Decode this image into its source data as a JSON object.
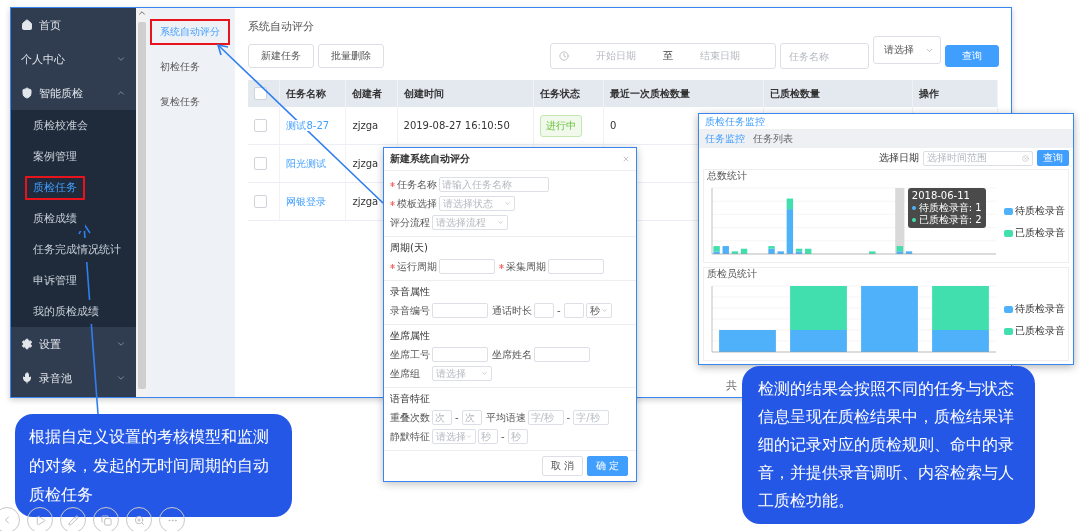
{
  "sidebar": {
    "items": [
      {
        "label": "首页",
        "kind": "link",
        "selected": false
      },
      {
        "label": "个人中心",
        "kind": "group",
        "expanded": false
      },
      {
        "label": "智能质检",
        "kind": "group",
        "expanded": true,
        "children": [
          {
            "label": "质检校准会",
            "selected": false,
            "highlighted": false
          },
          {
            "label": "案例管理",
            "selected": false,
            "highlighted": false
          },
          {
            "label": "质检任务",
            "selected": true,
            "highlighted": true
          },
          {
            "label": "质检成绩",
            "selected": false,
            "highlighted": false
          },
          {
            "label": "任务完成情况统计",
            "selected": false,
            "highlighted": false
          },
          {
            "label": "申诉管理",
            "selected": false,
            "highlighted": false
          },
          {
            "label": "我的质检成绩",
            "selected": false,
            "highlighted": false
          }
        ]
      },
      {
        "label": "设置",
        "kind": "group",
        "expanded": false
      },
      {
        "label": "录音池",
        "kind": "group",
        "expanded": false
      }
    ]
  },
  "subnav": [
    {
      "label": "系统自动评分",
      "selected": true,
      "highlighted": true
    },
    {
      "label": "初检任务",
      "selected": false,
      "highlighted": false
    },
    {
      "label": "复检任务",
      "selected": false,
      "highlighted": false
    }
  ],
  "page": {
    "title": "系统自动评分",
    "buttons": [
      "新建任务",
      "批量删除"
    ],
    "filters": {
      "start_placeholder": "开始日期",
      "range_separator": "至",
      "end_placeholder": "结束日期",
      "name_placeholder": "任务名称",
      "select_placeholder": "请选择",
      "query_button": "查询"
    }
  },
  "table": {
    "header_checked": false,
    "columns": [
      "任务名称",
      "创建者",
      "创建时间",
      "任务状态",
      "最近一次质检数量",
      "已质检数量",
      "操作"
    ],
    "rows": [
      {
        "checked": false,
        "cells": [
          "测试8-27",
          "zjzga",
          "2019-08-27 16:10:50",
          "进行中",
          "0"
        ]
      },
      {
        "checked": false,
        "cells": [
          "阳光测试",
          "zjzga"
        ]
      },
      {
        "checked": false,
        "cells": [
          "网银登录",
          "zjzga"
        ]
      }
    ]
  },
  "pagination_text": "共",
  "dialog": {
    "title": "新建系统自动评分",
    "sections": [
      {
        "rows": [
          [
            {
              "label": "任务名称",
              "required": true,
              "kind": "input",
              "placeholder": "请输入任务名称"
            }
          ],
          [
            {
              "label": "模板选择",
              "required": true,
              "kind": "select",
              "placeholder": "请选择状态"
            }
          ],
          [
            {
              "label": "评分流程",
              "required": false,
              "kind": "select",
              "placeholder": "请选择流程"
            }
          ]
        ]
      },
      {
        "title": "周期(天)",
        "rows": [
          [
            {
              "label": "运行周期",
              "required": true,
              "kind": "input"
            },
            {
              "label": "采集周期",
              "required": true,
              "kind": "input"
            }
          ]
        ]
      },
      {
        "title": "录音属性",
        "rows": [
          [
            {
              "label": "录音编号",
              "required": false,
              "kind": "input"
            },
            {
              "label": "通话时长",
              "required": false,
              "kind": "range",
              "separator": "-",
              "unit": "秒"
            }
          ]
        ]
      },
      {
        "title": "坐席属性",
        "rows": [
          [
            {
              "label": "坐席工号",
              "required": false,
              "kind": "input"
            },
            {
              "label": "坐席姓名",
              "required": false,
              "kind": "input"
            }
          ],
          [
            {
              "label": "坐席组",
              "required": false,
              "kind": "select",
              "placeholder": "请选择"
            }
          ]
        ]
      },
      {
        "title": "语音特征",
        "rows": [
          [
            {
              "label": "重叠次数",
              "required": false,
              "kind": "range",
              "separator": "-",
              "from_placeholder": "次",
              "to_placeholder": "次"
            },
            {
              "label": "平均语速",
              "required": false,
              "kind": "range",
              "separator": "-",
              "from_placeholder": "字/秒",
              "to_placeholder": "字/秒"
            }
          ],
          [
            {
              "label": "静默特征",
              "required": false,
              "kind": "select_range",
              "placeholder": "请选择",
              "separator": "-",
              "from_placeholder": "秒",
              "to_placeholder": "秒"
            }
          ]
        ]
      }
    ],
    "buttons": [
      {
        "label": "取 消",
        "kind": "secondary"
      },
      {
        "label": "确 定",
        "kind": "primary"
      }
    ]
  },
  "monitor": {
    "title": "质检任务监控",
    "tabs": [
      {
        "label": "任务监控",
        "selected": true
      },
      {
        "label": "任务列表",
        "selected": false
      }
    ],
    "date_label": "选择日期",
    "date_placeholder": "选择时间范围",
    "query_button": "查询",
    "charts": [
      {
        "title": "总数统计",
        "legend": [
          {
            "name": "待质检录音",
            "color": "#4fb1f9"
          },
          {
            "name": "已质检录音",
            "color": "#40dfad"
          }
        ],
        "tooltip": {
          "title": "2018-06-11",
          "lines": [
            "待质检录音: 1",
            "已质检录音: 2"
          ]
        }
      },
      {
        "title": "质检员统计",
        "legend": [
          {
            "name": "待质检录音",
            "color": "#4fb1f9"
          },
          {
            "name": "已质检录音",
            "color": "#40dfad"
          }
        ]
      }
    ]
  },
  "callouts": [
    "根据自定义设置的考核模型和监测的对象，发起的无时间周期的自动质检任务",
    "检测的结果会按照不同的任务与状态信息呈现在质检结果中，质检结果详细的记录对应的质检规则、命中的录音，并提供录音调听、内容检索与人工质检功能。"
  ]
}
